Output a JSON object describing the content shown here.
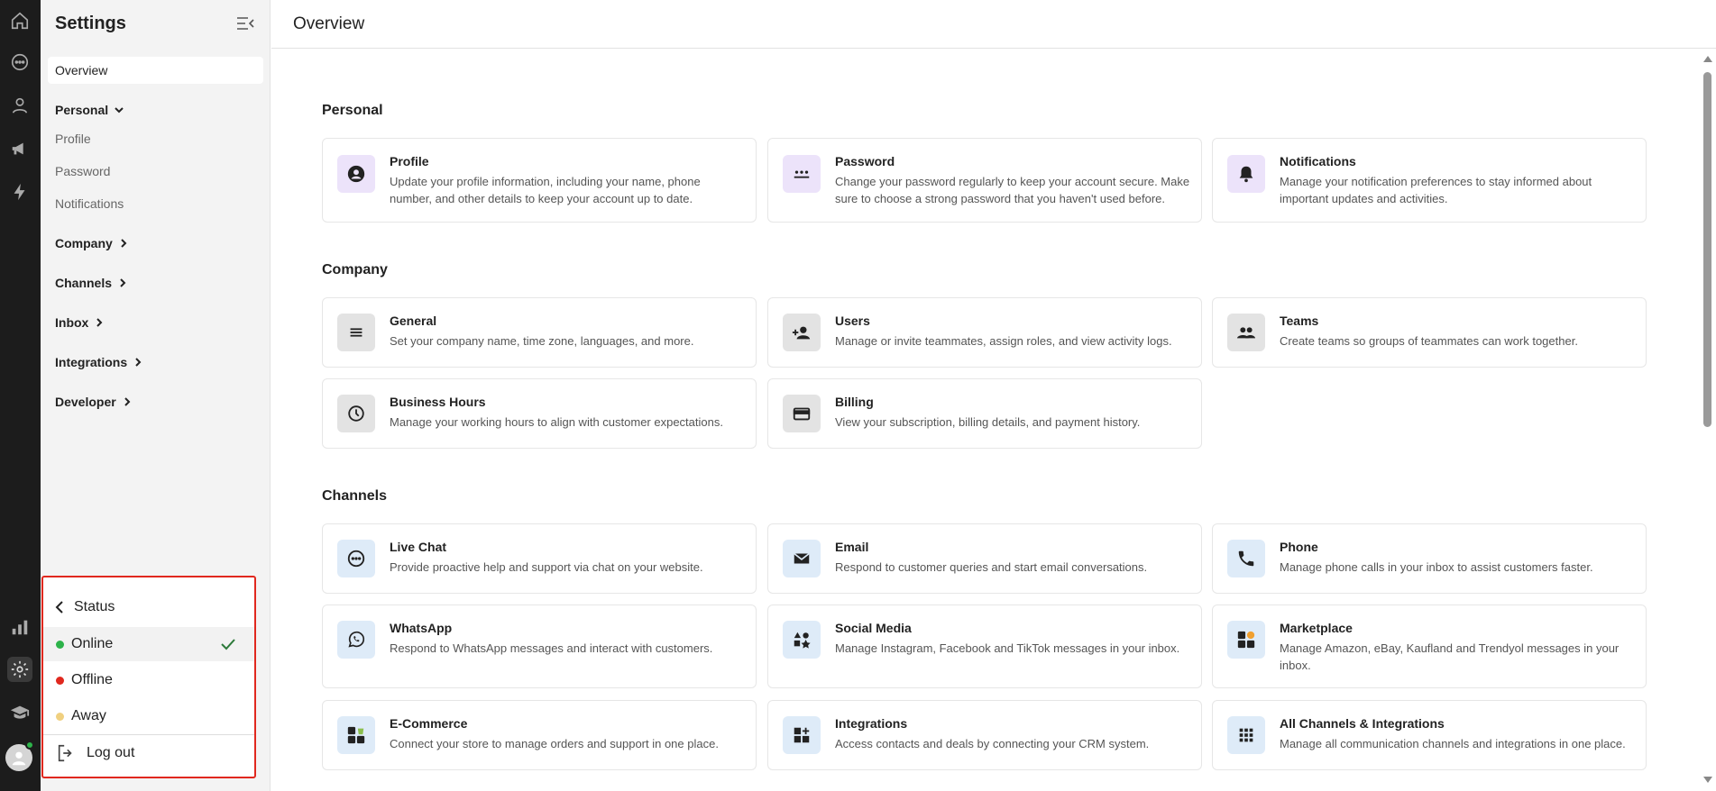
{
  "sidebar": {
    "title": "Settings",
    "overview": "Overview",
    "groups": {
      "personal": "Personal",
      "company": "Company",
      "channels": "Channels",
      "inbox": "Inbox",
      "integrations": "Integrations",
      "developer": "Developer"
    },
    "personal_items": [
      "Profile",
      "Password",
      "Notifications"
    ]
  },
  "header": {
    "title": "Overview"
  },
  "sections": {
    "personal": {
      "title": "Personal",
      "cards": [
        {
          "title": "Profile",
          "desc": "Update your profile information, including your name, phone number, and other details to keep your account up to date.",
          "icon": "person-circle-icon"
        },
        {
          "title": "Password",
          "desc": "Change your password regularly to keep your account secure. Make sure to choose a strong password that you haven't used before.",
          "icon": "password-dots-icon"
        },
        {
          "title": "Notifications",
          "desc": "Manage your notification preferences to stay informed about important updates and activities.",
          "icon": "bell-icon"
        }
      ]
    },
    "company": {
      "title": "Company",
      "cards": [
        {
          "title": "General",
          "desc": "Set your company name, time zone, languages, and more.",
          "icon": "menu-lines-icon"
        },
        {
          "title": "Users",
          "desc": "Manage or invite teammates, assign roles, and view activity logs.",
          "icon": "add-user-icon"
        },
        {
          "title": "Teams",
          "desc": "Create teams so groups of teammates can work together.",
          "icon": "group-icon"
        },
        {
          "title": "Business Hours",
          "desc": "Manage your working hours to align with customer expectations.",
          "icon": "clock-icon"
        },
        {
          "title": "Billing",
          "desc": "View your subscription, billing details, and payment history.",
          "icon": "credit-card-icon"
        }
      ]
    },
    "channels": {
      "title": "Channels",
      "cards": [
        {
          "title": "Live Chat",
          "desc": "Provide proactive help and support via chat on your website.",
          "icon": "chat-bubble-icon"
        },
        {
          "title": "Email",
          "desc": "Respond to customer queries and start email conversations.",
          "icon": "envelope-icon"
        },
        {
          "title": "Phone",
          "desc": "Manage phone calls in your inbox to assist customers faster.",
          "icon": "phone-icon"
        },
        {
          "title": "WhatsApp",
          "desc": "Respond to WhatsApp messages and interact with customers.",
          "icon": "whatsapp-icon"
        },
        {
          "title": "Social Media",
          "desc": "Manage Instagram, Facebook and TikTok messages in your inbox.",
          "icon": "shapes-icon"
        },
        {
          "title": "Marketplace",
          "desc": "Manage Amazon, eBay, Kaufland and Trendyol messages in your inbox.",
          "icon": "marketplace-icon"
        },
        {
          "title": "E-Commerce",
          "desc": "Connect your store to manage orders and support in one place.",
          "icon": "ecommerce-icon"
        },
        {
          "title": "Integrations",
          "desc": "Access contacts and deals by connecting your CRM system.",
          "icon": "widgets-add-icon"
        },
        {
          "title": "All Channels & Integrations",
          "desc": "Manage all communication channels and integrations in one place.",
          "icon": "grid-dots-icon"
        }
      ]
    }
  },
  "status_popup": {
    "header": "Status",
    "options": [
      "Online",
      "Offline",
      "Away"
    ],
    "selected": "Online",
    "logout": "Log out"
  },
  "colors": {
    "online": "#2db34a",
    "offline": "#e0281e",
    "away": "#f0d080",
    "popup_border": "#e0281e",
    "icon_purple": "#ece3fa",
    "icon_gray": "#e3e3e3",
    "icon_blue": "#deebf8"
  }
}
